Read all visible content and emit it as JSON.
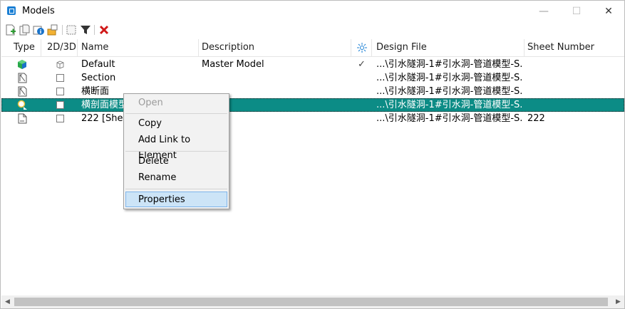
{
  "window": {
    "title": "Models",
    "minimize_glyph": "—",
    "maximize_glyph": "☐",
    "close_glyph": "✕"
  },
  "toolbar": {
    "items": [
      {
        "icon": "new-model-icon"
      },
      {
        "icon": "copy-model-icon"
      },
      {
        "icon": "model-properties-icon"
      },
      {
        "icon": "import-model-icon"
      },
      {
        "icon": "select-all-icon"
      },
      {
        "icon": "filter-icon"
      },
      {
        "icon": "delete-icon"
      }
    ],
    "delete_color": "#d01818"
  },
  "columns": {
    "type": "Type",
    "dim": "2D/3D",
    "name": "Name",
    "description": "Description",
    "design_file": "Design File",
    "sheet_number": "Sheet Number"
  },
  "rows": [
    {
      "type_icon": "3d-model-icon",
      "name": "Default",
      "description": "Master Model",
      "active_mark": "✓",
      "design_file": "...\\引水隧洞-1#引水洞-管道模型-S...",
      "sheet_number": ""
    },
    {
      "type_icon": "drawing-model-icon",
      "name": "Section",
      "description": "",
      "active_mark": "",
      "design_file": "...\\引水隧洞-1#引水洞-管道模型-S...",
      "sheet_number": ""
    },
    {
      "type_icon": "drawing-model-icon",
      "name": "横断面",
      "description": "",
      "active_mark": "",
      "design_file": "...\\引水隧洞-1#引水洞-管道模型-S...",
      "sheet_number": ""
    },
    {
      "type_icon": "design-model-icon",
      "name": "横剖面模型",
      "description": "",
      "active_mark": "",
      "design_file": "...\\引水隧洞-1#引水洞-管道模型-S...",
      "sheet_number": "",
      "selected": true
    },
    {
      "type_icon": "sheet-model-icon",
      "name": "222 [Sheet]",
      "description": "",
      "active_mark": "",
      "design_file": "...\\引水隧洞-1#引水洞-管道模型-S...",
      "sheet_number": "222"
    }
  ],
  "context_menu": {
    "open": "Open",
    "copy": "Copy",
    "add_link": "Add Link to Element",
    "delete": "Delete",
    "rename": "Rename",
    "properties": "Properties"
  },
  "colors": {
    "selection": "#0c8c86",
    "menu_highlight": "#cce4f7",
    "title_icon": "#1a7fd4"
  },
  "scrollbar": {
    "left_arrow": "◀",
    "right_arrow": "▶"
  }
}
